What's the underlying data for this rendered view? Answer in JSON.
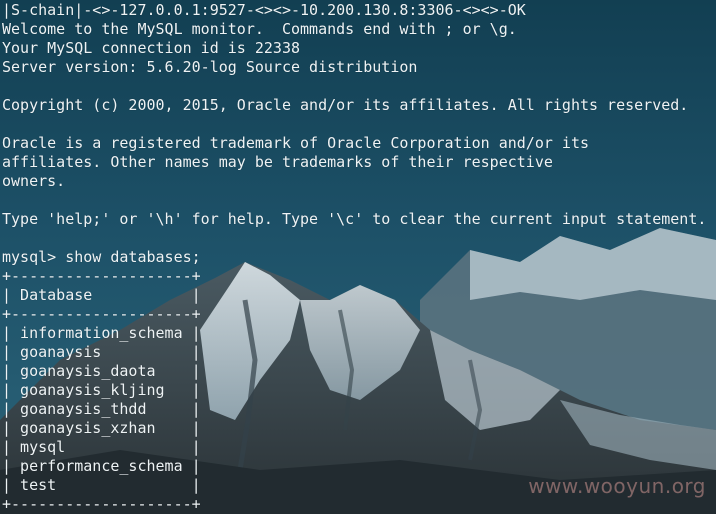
{
  "terminal": {
    "lines": {
      "0": "|S-chain|-<>-127.0.0.1:9527-<><>-10.200.130.8:3306-<><>-OK",
      "1": "Welcome to the MySQL monitor.  Commands end with ; or \\g.",
      "2": "Your MySQL connection id is 22338",
      "3": "Server version: 5.6.20-log Source distribution",
      "4": "",
      "5": "Copyright (c) 2000, 2015, Oracle and/or its affiliates. All rights reserved.",
      "6": "",
      "7": "Oracle is a registered trademark of Oracle Corporation and/or its",
      "8": "affiliates. Other names may be trademarks of their respective",
      "9": "owners.",
      "10": "",
      "11": "Type 'help;' or '\\h' for help. Type '\\c' to clear the current input statement.",
      "12": "",
      "13": "mysql> show databases;",
      "14": "+--------------------+",
      "15": "| Database           |",
      "16": "+--------------------+",
      "17": "| information_schema |",
      "18": "| goanaysis          |",
      "19": "| goanaysis_daota    |",
      "20": "| goanaysis_kljing   |",
      "21": "| goanaysis_thdd     |",
      "22": "| goanaysis_xzhan    |",
      "23": "| mysql              |",
      "24": "| performance_schema |",
      "25": "| test               |",
      "26": "+--------------------+"
    }
  },
  "watermark": {
    "text": "www.wooyun.org"
  },
  "colors": {
    "text": "#eef3f5",
    "sky_top": "#16465a",
    "sky_bottom": "#2a6378",
    "snow": "#dfe9ee",
    "rock": "#3d4b52",
    "watermark": "#cd9691"
  }
}
